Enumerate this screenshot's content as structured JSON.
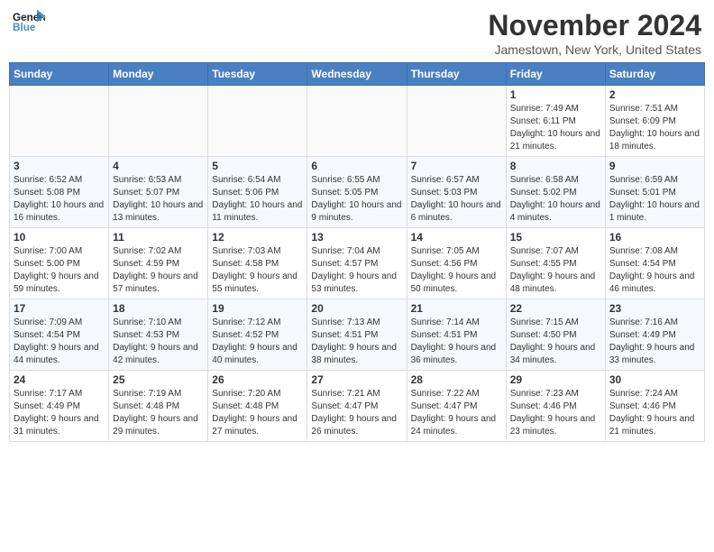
{
  "header": {
    "logo_line1": "General",
    "logo_line2": "Blue",
    "month": "November 2024",
    "location": "Jamestown, New York, United States"
  },
  "weekdays": [
    "Sunday",
    "Monday",
    "Tuesday",
    "Wednesday",
    "Thursday",
    "Friday",
    "Saturday"
  ],
  "weeks": [
    [
      {
        "day": "",
        "info": ""
      },
      {
        "day": "",
        "info": ""
      },
      {
        "day": "",
        "info": ""
      },
      {
        "day": "",
        "info": ""
      },
      {
        "day": "",
        "info": ""
      },
      {
        "day": "1",
        "info": "Sunrise: 7:49 AM\nSunset: 6:11 PM\nDaylight: 10 hours and 21 minutes."
      },
      {
        "day": "2",
        "info": "Sunrise: 7:51 AM\nSunset: 6:09 PM\nDaylight: 10 hours and 18 minutes."
      }
    ],
    [
      {
        "day": "3",
        "info": "Sunrise: 6:52 AM\nSunset: 5:08 PM\nDaylight: 10 hours and 16 minutes."
      },
      {
        "day": "4",
        "info": "Sunrise: 6:53 AM\nSunset: 5:07 PM\nDaylight: 10 hours and 13 minutes."
      },
      {
        "day": "5",
        "info": "Sunrise: 6:54 AM\nSunset: 5:06 PM\nDaylight: 10 hours and 11 minutes."
      },
      {
        "day": "6",
        "info": "Sunrise: 6:55 AM\nSunset: 5:05 PM\nDaylight: 10 hours and 9 minutes."
      },
      {
        "day": "7",
        "info": "Sunrise: 6:57 AM\nSunset: 5:03 PM\nDaylight: 10 hours and 6 minutes."
      },
      {
        "day": "8",
        "info": "Sunrise: 6:58 AM\nSunset: 5:02 PM\nDaylight: 10 hours and 4 minutes."
      },
      {
        "day": "9",
        "info": "Sunrise: 6:59 AM\nSunset: 5:01 PM\nDaylight: 10 hours and 1 minute."
      }
    ],
    [
      {
        "day": "10",
        "info": "Sunrise: 7:00 AM\nSunset: 5:00 PM\nDaylight: 9 hours and 59 minutes."
      },
      {
        "day": "11",
        "info": "Sunrise: 7:02 AM\nSunset: 4:59 PM\nDaylight: 9 hours and 57 minutes."
      },
      {
        "day": "12",
        "info": "Sunrise: 7:03 AM\nSunset: 4:58 PM\nDaylight: 9 hours and 55 minutes."
      },
      {
        "day": "13",
        "info": "Sunrise: 7:04 AM\nSunset: 4:57 PM\nDaylight: 9 hours and 53 minutes."
      },
      {
        "day": "14",
        "info": "Sunrise: 7:05 AM\nSunset: 4:56 PM\nDaylight: 9 hours and 50 minutes."
      },
      {
        "day": "15",
        "info": "Sunrise: 7:07 AM\nSunset: 4:55 PM\nDaylight: 9 hours and 48 minutes."
      },
      {
        "day": "16",
        "info": "Sunrise: 7:08 AM\nSunset: 4:54 PM\nDaylight: 9 hours and 46 minutes."
      }
    ],
    [
      {
        "day": "17",
        "info": "Sunrise: 7:09 AM\nSunset: 4:54 PM\nDaylight: 9 hours and 44 minutes."
      },
      {
        "day": "18",
        "info": "Sunrise: 7:10 AM\nSunset: 4:53 PM\nDaylight: 9 hours and 42 minutes."
      },
      {
        "day": "19",
        "info": "Sunrise: 7:12 AM\nSunset: 4:52 PM\nDaylight: 9 hours and 40 minutes."
      },
      {
        "day": "20",
        "info": "Sunrise: 7:13 AM\nSunset: 4:51 PM\nDaylight: 9 hours and 38 minutes."
      },
      {
        "day": "21",
        "info": "Sunrise: 7:14 AM\nSunset: 4:51 PM\nDaylight: 9 hours and 36 minutes."
      },
      {
        "day": "22",
        "info": "Sunrise: 7:15 AM\nSunset: 4:50 PM\nDaylight: 9 hours and 34 minutes."
      },
      {
        "day": "23",
        "info": "Sunrise: 7:16 AM\nSunset: 4:49 PM\nDaylight: 9 hours and 33 minutes."
      }
    ],
    [
      {
        "day": "24",
        "info": "Sunrise: 7:17 AM\nSunset: 4:49 PM\nDaylight: 9 hours and 31 minutes."
      },
      {
        "day": "25",
        "info": "Sunrise: 7:19 AM\nSunset: 4:48 PM\nDaylight: 9 hours and 29 minutes."
      },
      {
        "day": "26",
        "info": "Sunrise: 7:20 AM\nSunset: 4:48 PM\nDaylight: 9 hours and 27 minutes."
      },
      {
        "day": "27",
        "info": "Sunrise: 7:21 AM\nSunset: 4:47 PM\nDaylight: 9 hours and 26 minutes."
      },
      {
        "day": "28",
        "info": "Sunrise: 7:22 AM\nSunset: 4:47 PM\nDaylight: 9 hours and 24 minutes."
      },
      {
        "day": "29",
        "info": "Sunrise: 7:23 AM\nSunset: 4:46 PM\nDaylight: 9 hours and 23 minutes."
      },
      {
        "day": "30",
        "info": "Sunrise: 7:24 AM\nSunset: 4:46 PM\nDaylight: 9 hours and 21 minutes."
      }
    ]
  ]
}
